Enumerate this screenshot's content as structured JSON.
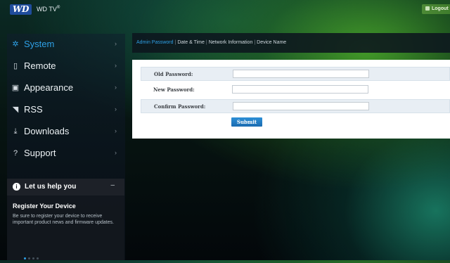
{
  "header": {
    "logo_text": "WD",
    "brand_name": "WD TV",
    "brand_mark": "®",
    "logout_label": "Logout"
  },
  "sidebar": {
    "items": [
      {
        "label": "System",
        "icon": "gear-icon",
        "active": true
      },
      {
        "label": "Remote",
        "icon": "remote-icon"
      },
      {
        "label": "Appearance",
        "icon": "image-icon"
      },
      {
        "label": "RSS",
        "icon": "rss-icon"
      },
      {
        "label": "Downloads",
        "icon": "download-icon"
      },
      {
        "label": "Support",
        "icon": "question-icon"
      }
    ],
    "help": {
      "title": "Let us help you",
      "collapse": "–",
      "register_title": "Register Your Device",
      "register_text": "Be sure to register your device to receive important product news and firmware updates."
    }
  },
  "tabs": [
    {
      "label": "Admin Password",
      "active": true
    },
    {
      "label": "Date & Time"
    },
    {
      "label": "Network Information"
    },
    {
      "label": "Device Name"
    }
  ],
  "form": {
    "old_password_label": "Old Password:",
    "new_password_label": "New Password:",
    "confirm_password_label": "Confirm Password:",
    "old_password_value": "",
    "new_password_value": "",
    "confirm_password_value": "",
    "submit_label": "Submit"
  },
  "colors": {
    "accent": "#2ea0e6",
    "logout": "#4d8a36",
    "logo_bg": "#1f4c9c"
  }
}
